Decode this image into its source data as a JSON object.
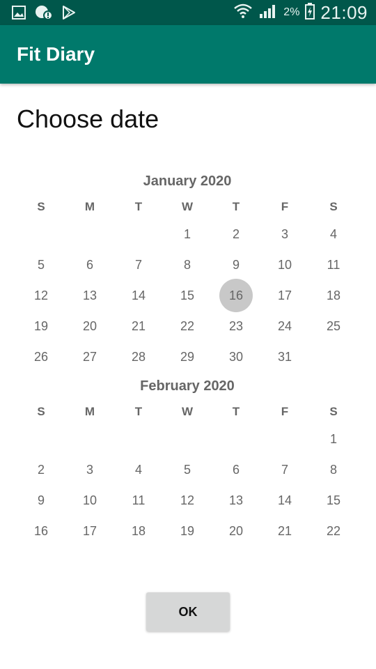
{
  "status_bar": {
    "icons": [
      "gallery-icon",
      "notification-icon",
      "play-store-icon",
      "wifi-icon",
      "signal-icon",
      "battery-icon"
    ],
    "battery_text": "2%",
    "time": "21:09"
  },
  "app_bar": {
    "title": "Fit Diary"
  },
  "dialog": {
    "title": "Choose date",
    "ok_label": "OK"
  },
  "calendar": {
    "weekdays": [
      "S",
      "M",
      "T",
      "W",
      "T",
      "F",
      "S"
    ],
    "selected": {
      "month": "January 2020",
      "day": 16
    },
    "months": [
      {
        "title": "January 2020",
        "first_weekday": 3,
        "days": [
          1,
          2,
          3,
          4,
          5,
          6,
          7,
          8,
          9,
          10,
          11,
          12,
          13,
          14,
          15,
          16,
          17,
          18,
          19,
          20,
          21,
          22,
          23,
          24,
          25,
          26,
          27,
          28,
          29,
          30,
          31
        ]
      },
      {
        "title": "February 2020",
        "first_weekday": 6,
        "days": [
          1,
          2,
          3,
          4,
          5,
          6,
          7,
          8,
          9,
          10,
          11,
          12,
          13,
          14,
          15,
          16,
          17,
          18,
          19,
          20,
          21,
          22
        ]
      }
    ]
  },
  "colors": {
    "status_bar": "#00574b",
    "app_bar": "#00796b",
    "selected_circle": "#c8c8c8",
    "button": "#d6d7d7"
  }
}
